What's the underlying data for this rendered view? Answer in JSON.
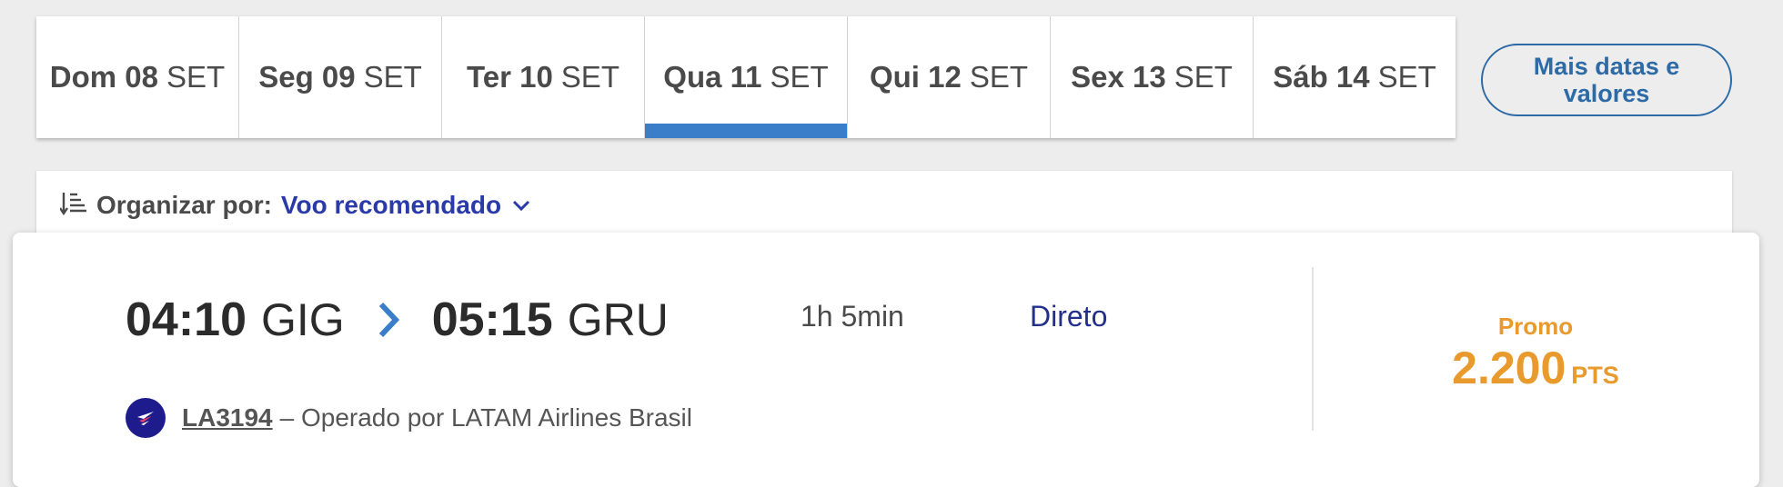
{
  "date_tabs": [
    {
      "day": "Dom 08",
      "month": "SET",
      "active": false
    },
    {
      "day": "Seg 09",
      "month": "SET",
      "active": false
    },
    {
      "day": "Ter 10",
      "month": "SET",
      "active": false
    },
    {
      "day": "Qua 11",
      "month": "SET",
      "active": true
    },
    {
      "day": "Qui 12",
      "month": "SET",
      "active": false
    },
    {
      "day": "Sex 13",
      "month": "SET",
      "active": false
    },
    {
      "day": "Sáb 14",
      "month": "SET",
      "active": false
    }
  ],
  "more_dates": {
    "label": "Mais datas e valores"
  },
  "sort": {
    "icon": "sort-icon",
    "label": "Organizar por:",
    "value": "Voo recomendado",
    "dropdown_icon": "chevron-down-icon"
  },
  "flight": {
    "departure_time": "04:10",
    "departure_airport": "GIG",
    "arrow_icon": "chevron-right-icon",
    "arrival_time": "05:15",
    "arrival_airport": "GRU",
    "duration": "1h 5min",
    "stops": "Direto",
    "fare_label": "Promo",
    "price": "2.200",
    "price_unit": "PTS",
    "airline_logo": "latam-logo-icon",
    "flight_number": "LA3194",
    "operated_by": "– Operado por LATAM Airlines Brasil"
  },
  "colors": {
    "active_tab_indicator": "#3a7dc9",
    "link_blue": "#2a3aa8",
    "stops_text": "#22308a",
    "price_orange": "#e99a2c",
    "airline_navy": "#1e1c8c"
  }
}
